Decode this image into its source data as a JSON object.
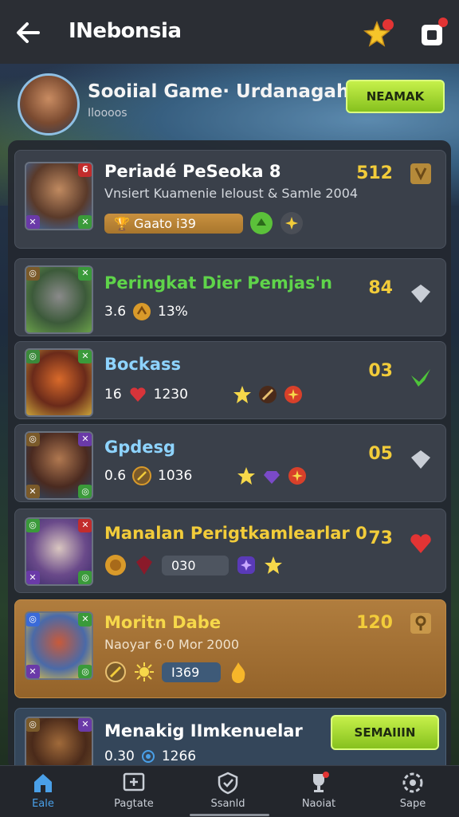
{
  "header": {
    "title": "INebonsia",
    "star_badge": "",
    "cube_badge": ""
  },
  "profile": {
    "name": "Sooiial Game· Urdanagah",
    "subtitle": "Iloooos",
    "action_label": "NEAMAK"
  },
  "cards": [
    {
      "title": "Periadé PeSeoka 8",
      "subtitle": "Vnsiert Kuamenie Ieloust & Samle 2004",
      "score": "512",
      "pill": "Gaato i39",
      "accent": "#f2cc3a"
    },
    {
      "title": "Peringkat Dier Pemjas'n",
      "stat1": "3.6",
      "stat2": "13%",
      "score": "84",
      "accent": "#5fd44a"
    },
    {
      "title": "Bockass",
      "stat1": "16",
      "stat2": "1230",
      "score": "03",
      "accent": "#8ed4ff"
    },
    {
      "title": "Gpdesg",
      "stat1": "0.6",
      "stat2": "1036",
      "score": "05",
      "accent": "#8ed4ff"
    },
    {
      "title": "Manalan Perigtkamlearlar 0",
      "pill": "030",
      "score": "73",
      "accent": "#f2cc3a"
    },
    {
      "title": "Moritn Dabe",
      "subtitle": "Naoyar 6·0 Mor 2000",
      "pill": "I369",
      "score": "120",
      "accent": "#f2cc3a"
    },
    {
      "title": "Menakig IImkenuelar",
      "stat1": "0.30",
      "stat2": "1266",
      "button": "SEMAIIIN"
    }
  ],
  "nav": [
    {
      "label": "Eale",
      "icon": "home-icon",
      "active": true
    },
    {
      "label": "Pagtate",
      "icon": "screen-icon"
    },
    {
      "label": "Ssanld",
      "icon": "shield-icon"
    },
    {
      "label": "Naoiat",
      "icon": "trophy-icon"
    },
    {
      "label": "Sape",
      "icon": "settings-icon"
    }
  ],
  "colors": {
    "accent_green": "#9ad52e",
    "score_gold": "#f2cc3a",
    "nav_active": "#4aa0e8"
  }
}
